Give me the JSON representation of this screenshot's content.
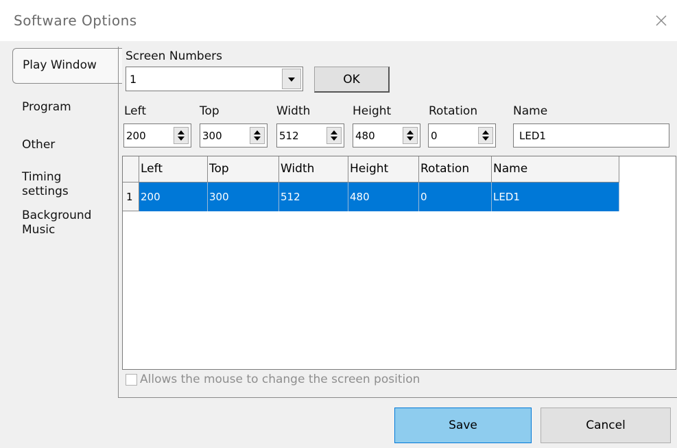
{
  "window": {
    "title": "Software Options"
  },
  "tabs": [
    {
      "label": "Play Window"
    },
    {
      "label": "Program"
    },
    {
      "label": "Other"
    },
    {
      "label": "Timing settings"
    },
    {
      "label": "Background Music"
    }
  ],
  "screen": {
    "numbers_label": "Screen Numbers",
    "selected_value": "1",
    "ok_label": "OK"
  },
  "fields": {
    "left": {
      "label": "Left",
      "value": "200"
    },
    "top": {
      "label": "Top",
      "value": "300"
    },
    "width": {
      "label": "Width",
      "value": "512"
    },
    "height": {
      "label": "Height",
      "value": "480"
    },
    "rotation": {
      "label": "Rotation",
      "value": "0"
    },
    "name": {
      "label": "Name",
      "value": "LED1"
    }
  },
  "grid": {
    "columns": [
      "Left",
      "Top",
      "Width",
      "Height",
      "Rotation",
      "Name"
    ],
    "rows": [
      {
        "index": "1",
        "cells": [
          "200",
          "300",
          "512",
          "480",
          "0",
          "LED1"
        ]
      }
    ]
  },
  "options": {
    "mouse_change_label": "Allows the mouse to change the screen position"
  },
  "buttons": {
    "save_label": "Save",
    "cancel_label": "Cancel"
  },
  "colors": {
    "selection": "#0078d7",
    "save_button": "#5bb8e8"
  }
}
